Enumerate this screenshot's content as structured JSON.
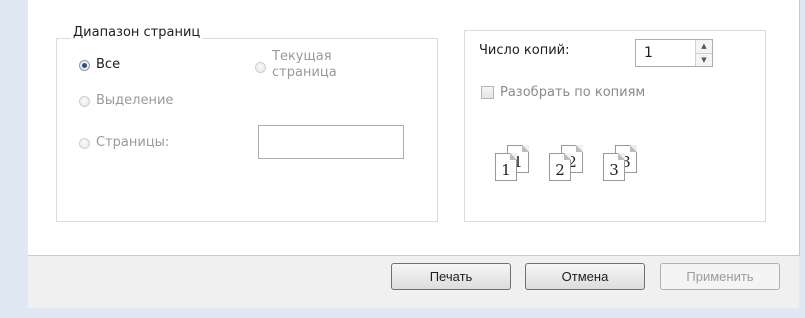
{
  "page_range": {
    "legend": "Диапазон страниц",
    "all_label": "Все",
    "current_page_label": "Текущая\nстраница",
    "current_page_line1": "Текущая",
    "current_page_line2": "страница",
    "selection_label": "Выделение",
    "pages_label": "Страницы:",
    "pages_value": "",
    "selected": "all"
  },
  "copies": {
    "label": "Число копий:",
    "value": "1",
    "collate_label": "Разобрать по копиям",
    "collate_checked": false,
    "illustration": [
      {
        "back": "1",
        "front": "1"
      },
      {
        "back": "2",
        "front": "2"
      },
      {
        "back": "3",
        "front": "3"
      }
    ]
  },
  "buttons": {
    "print": "Печать",
    "cancel": "Отмена",
    "apply": "Применить"
  }
}
